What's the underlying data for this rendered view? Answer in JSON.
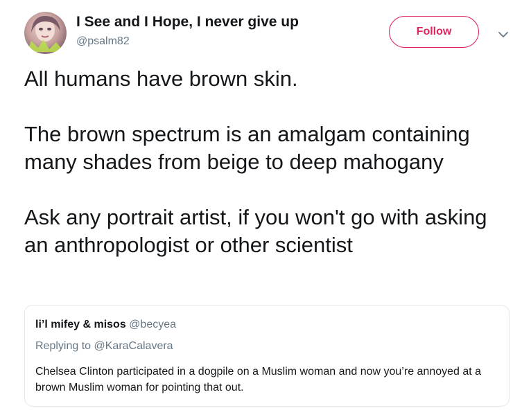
{
  "author": {
    "display_name": "I See and I Hope, I never give up",
    "handle": "@psalm82",
    "avatar_icon": "user-avatar-photo"
  },
  "actions": {
    "follow_label": "Follow",
    "more_icon": "chevron-down-icon"
  },
  "tweet": {
    "paragraphs": [
      "All humans have brown skin.",
      "The brown spectrum is an amalgam containing many shades from beige to deep mahogany",
      "Ask any portrait artist, if you won't go with asking an anthropologist or other scientist"
    ]
  },
  "quoted_tweet": {
    "display_name": "li’l mifey & misos",
    "handle": "@becyea",
    "replying_prefix": "Replying to",
    "replying_to": "@KaraCalavera",
    "text": "Chelsea Clinton participated in a dogpile on a Muslim woman and now you’re annoyed at a brown Muslim woman for pointing that out."
  },
  "colors": {
    "follow_accent": "#e0245e",
    "secondary_text": "#657786",
    "primary_text": "#14171a",
    "border": "#e1e8ed"
  }
}
